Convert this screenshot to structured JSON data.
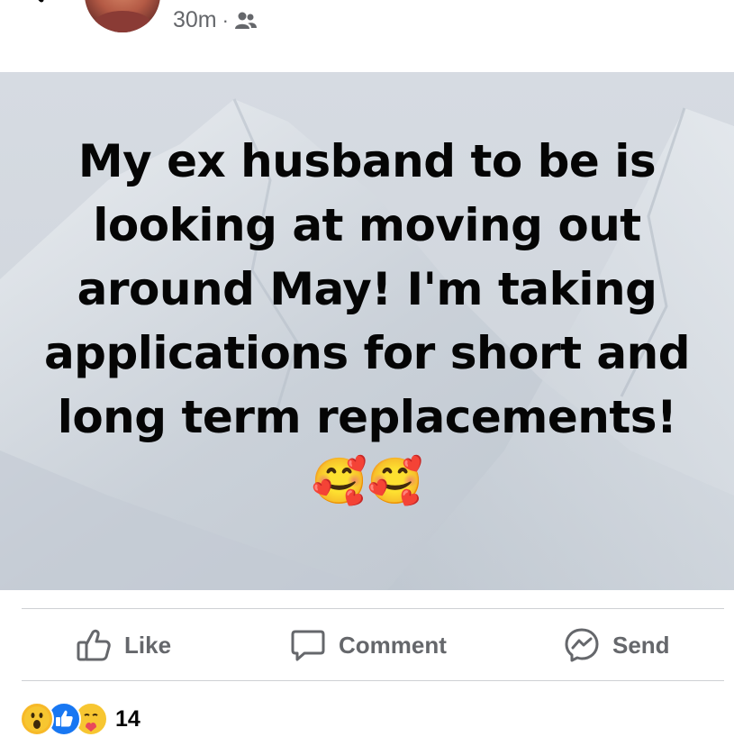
{
  "header": {
    "timestamp": "30m",
    "separator": "·",
    "audience_icon": "friends-icon"
  },
  "post": {
    "text": "My ex husband to be is looking at moving out around May! I'm taking applications for short and long term replacements! 🥰🥰",
    "background": "snowy-mountain"
  },
  "actions": {
    "like_label": "Like",
    "comment_label": "Comment",
    "send_label": "Send"
  },
  "reactions": {
    "icons": [
      "wow-reaction-icon",
      "like-reaction-icon",
      "care-reaction-icon"
    ],
    "count": "14"
  },
  "colors": {
    "action_gray": "#65676b",
    "like_blue": "#1877f2",
    "divider": "#ced0d4"
  }
}
